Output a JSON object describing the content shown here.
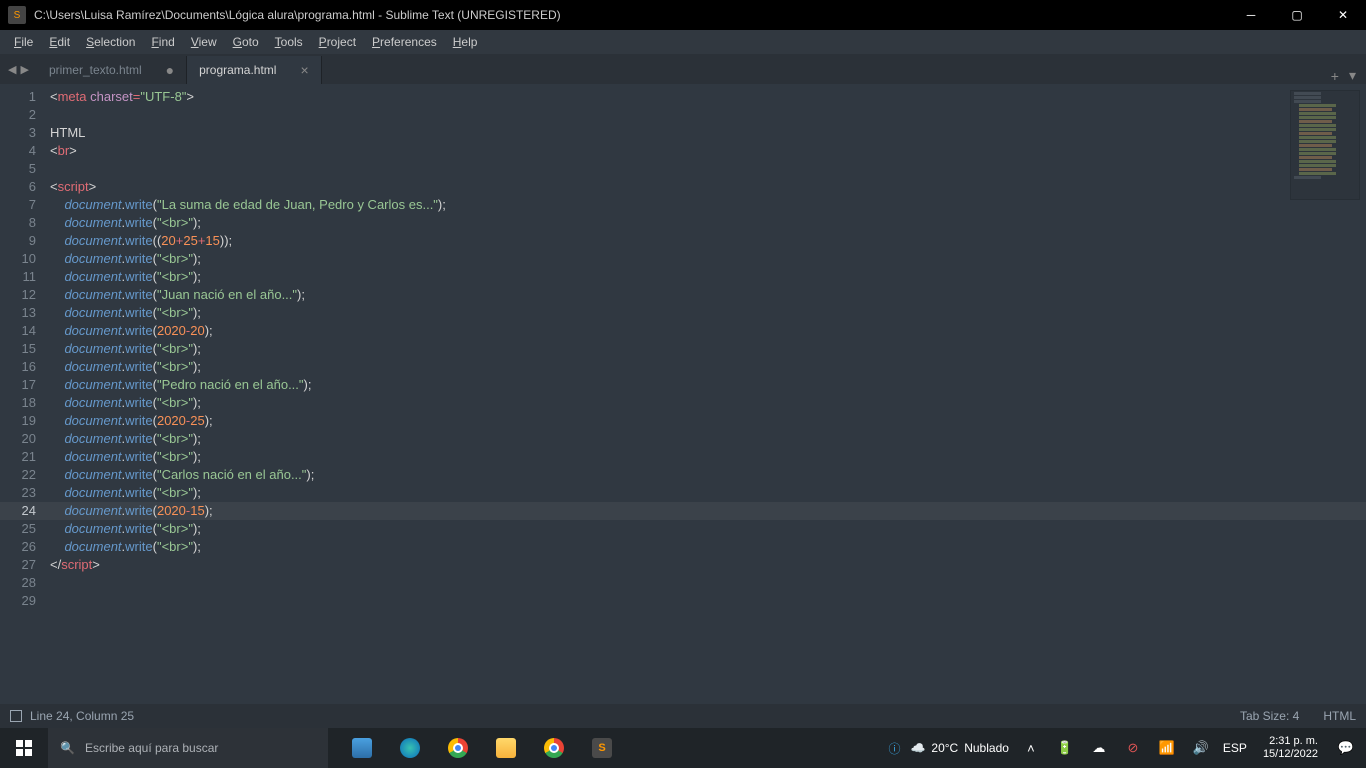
{
  "title": "C:\\Users\\Luisa Ramírez\\Documents\\Lógica alura\\programa.html - Sublime Text (UNREGISTERED)",
  "menus": [
    "File",
    "Edit",
    "Selection",
    "Find",
    "View",
    "Goto",
    "Tools",
    "Project",
    "Preferences",
    "Help"
  ],
  "tabs": [
    {
      "name": "primer_texto.html",
      "active": false,
      "dirty": true
    },
    {
      "name": "programa.html",
      "active": true,
      "dirty": false
    }
  ],
  "code_lines": [
    [
      {
        "c": "tok-punc",
        "t": "<"
      },
      {
        "c": "tok-tag",
        "t": "meta"
      },
      {
        "c": "tok-plain",
        "t": " "
      },
      {
        "c": "tok-attr",
        "t": "charset"
      },
      {
        "c": "tok-op",
        "t": "="
      },
      {
        "c": "tok-str",
        "t": "\"UTF-8\""
      },
      {
        "c": "tok-punc",
        "t": ">"
      }
    ],
    [],
    [
      {
        "c": "tok-text",
        "t": "HTML"
      }
    ],
    [
      {
        "c": "tok-punc",
        "t": "<"
      },
      {
        "c": "tok-tag",
        "t": "br"
      },
      {
        "c": "tok-punc",
        "t": ">"
      }
    ],
    [],
    [
      {
        "c": "tok-punc",
        "t": "<"
      },
      {
        "c": "tok-tag",
        "t": "script"
      },
      {
        "c": "tok-punc",
        "t": ">"
      }
    ],
    [
      {
        "c": "tok-plain",
        "t": "    "
      },
      {
        "c": "tok-kw",
        "t": "document"
      },
      {
        "c": "tok-punc",
        "t": "."
      },
      {
        "c": "tok-func",
        "t": "write"
      },
      {
        "c": "tok-punc",
        "t": "("
      },
      {
        "c": "tok-str",
        "t": "\"La suma de edad de Juan, Pedro y Carlos es...\""
      },
      {
        "c": "tok-punc",
        "t": ");"
      }
    ],
    [
      {
        "c": "tok-plain",
        "t": "    "
      },
      {
        "c": "tok-kw",
        "t": "document"
      },
      {
        "c": "tok-punc",
        "t": "."
      },
      {
        "c": "tok-func",
        "t": "write"
      },
      {
        "c": "tok-punc",
        "t": "("
      },
      {
        "c": "tok-str",
        "t": "\"<br>\""
      },
      {
        "c": "tok-punc",
        "t": ");"
      }
    ],
    [
      {
        "c": "tok-plain",
        "t": "    "
      },
      {
        "c": "tok-kw",
        "t": "document"
      },
      {
        "c": "tok-punc",
        "t": "."
      },
      {
        "c": "tok-func",
        "t": "write"
      },
      {
        "c": "tok-punc",
        "t": "(("
      },
      {
        "c": "tok-num",
        "t": "20"
      },
      {
        "c": "tok-op",
        "t": "+"
      },
      {
        "c": "tok-num",
        "t": "25"
      },
      {
        "c": "tok-op",
        "t": "+"
      },
      {
        "c": "tok-num",
        "t": "15"
      },
      {
        "c": "tok-punc",
        "t": "));"
      }
    ],
    [
      {
        "c": "tok-plain",
        "t": "    "
      },
      {
        "c": "tok-kw",
        "t": "document"
      },
      {
        "c": "tok-punc",
        "t": "."
      },
      {
        "c": "tok-func",
        "t": "write"
      },
      {
        "c": "tok-punc",
        "t": "("
      },
      {
        "c": "tok-str",
        "t": "\"<br>\""
      },
      {
        "c": "tok-punc",
        "t": ");"
      }
    ],
    [
      {
        "c": "tok-plain",
        "t": "    "
      },
      {
        "c": "tok-kw",
        "t": "document"
      },
      {
        "c": "tok-punc",
        "t": "."
      },
      {
        "c": "tok-func",
        "t": "write"
      },
      {
        "c": "tok-punc",
        "t": "("
      },
      {
        "c": "tok-str",
        "t": "\"<br>\""
      },
      {
        "c": "tok-punc",
        "t": ");"
      }
    ],
    [
      {
        "c": "tok-plain",
        "t": "    "
      },
      {
        "c": "tok-kw",
        "t": "document"
      },
      {
        "c": "tok-punc",
        "t": "."
      },
      {
        "c": "tok-func",
        "t": "write"
      },
      {
        "c": "tok-punc",
        "t": "("
      },
      {
        "c": "tok-str",
        "t": "\"Juan nació en el año...\""
      },
      {
        "c": "tok-punc",
        "t": ");"
      }
    ],
    [
      {
        "c": "tok-plain",
        "t": "    "
      },
      {
        "c": "tok-kw",
        "t": "document"
      },
      {
        "c": "tok-punc",
        "t": "."
      },
      {
        "c": "tok-func",
        "t": "write"
      },
      {
        "c": "tok-punc",
        "t": "("
      },
      {
        "c": "tok-str",
        "t": "\"<br>\""
      },
      {
        "c": "tok-punc",
        "t": ");"
      }
    ],
    [
      {
        "c": "tok-plain",
        "t": "    "
      },
      {
        "c": "tok-kw",
        "t": "document"
      },
      {
        "c": "tok-punc",
        "t": "."
      },
      {
        "c": "tok-func",
        "t": "write"
      },
      {
        "c": "tok-punc",
        "t": "("
      },
      {
        "c": "tok-num",
        "t": "2020"
      },
      {
        "c": "tok-op",
        "t": "-"
      },
      {
        "c": "tok-num",
        "t": "20"
      },
      {
        "c": "tok-punc",
        "t": ");"
      }
    ],
    [
      {
        "c": "tok-plain",
        "t": "    "
      },
      {
        "c": "tok-kw",
        "t": "document"
      },
      {
        "c": "tok-punc",
        "t": "."
      },
      {
        "c": "tok-func",
        "t": "write"
      },
      {
        "c": "tok-punc",
        "t": "("
      },
      {
        "c": "tok-str",
        "t": "\"<br>\""
      },
      {
        "c": "tok-punc",
        "t": ");"
      }
    ],
    [
      {
        "c": "tok-plain",
        "t": "    "
      },
      {
        "c": "tok-kw",
        "t": "document"
      },
      {
        "c": "tok-punc",
        "t": "."
      },
      {
        "c": "tok-func",
        "t": "write"
      },
      {
        "c": "tok-punc",
        "t": "("
      },
      {
        "c": "tok-str",
        "t": "\"<br>\""
      },
      {
        "c": "tok-punc",
        "t": ");"
      }
    ],
    [
      {
        "c": "tok-plain",
        "t": "    "
      },
      {
        "c": "tok-kw",
        "t": "document"
      },
      {
        "c": "tok-punc",
        "t": "."
      },
      {
        "c": "tok-func",
        "t": "write"
      },
      {
        "c": "tok-punc",
        "t": "("
      },
      {
        "c": "tok-str",
        "t": "\"Pedro nació en el año...\""
      },
      {
        "c": "tok-punc",
        "t": ");"
      }
    ],
    [
      {
        "c": "tok-plain",
        "t": "    "
      },
      {
        "c": "tok-kw",
        "t": "document"
      },
      {
        "c": "tok-punc",
        "t": "."
      },
      {
        "c": "tok-func",
        "t": "write"
      },
      {
        "c": "tok-punc",
        "t": "("
      },
      {
        "c": "tok-str",
        "t": "\"<br>\""
      },
      {
        "c": "tok-punc",
        "t": ");"
      }
    ],
    [
      {
        "c": "tok-plain",
        "t": "    "
      },
      {
        "c": "tok-kw",
        "t": "document"
      },
      {
        "c": "tok-punc",
        "t": "."
      },
      {
        "c": "tok-func",
        "t": "write"
      },
      {
        "c": "tok-punc",
        "t": "("
      },
      {
        "c": "tok-num",
        "t": "2020"
      },
      {
        "c": "tok-op",
        "t": "-"
      },
      {
        "c": "tok-num",
        "t": "25"
      },
      {
        "c": "tok-punc",
        "t": ");"
      }
    ],
    [
      {
        "c": "tok-plain",
        "t": "    "
      },
      {
        "c": "tok-kw",
        "t": "document"
      },
      {
        "c": "tok-punc",
        "t": "."
      },
      {
        "c": "tok-func",
        "t": "write"
      },
      {
        "c": "tok-punc",
        "t": "("
      },
      {
        "c": "tok-str",
        "t": "\"<br>\""
      },
      {
        "c": "tok-punc",
        "t": ");"
      }
    ],
    [
      {
        "c": "tok-plain",
        "t": "    "
      },
      {
        "c": "tok-kw",
        "t": "document"
      },
      {
        "c": "tok-punc",
        "t": "."
      },
      {
        "c": "tok-func",
        "t": "write"
      },
      {
        "c": "tok-punc",
        "t": "("
      },
      {
        "c": "tok-str",
        "t": "\"<br>\""
      },
      {
        "c": "tok-punc",
        "t": ");"
      }
    ],
    [
      {
        "c": "tok-plain",
        "t": "    "
      },
      {
        "c": "tok-kw",
        "t": "document"
      },
      {
        "c": "tok-punc",
        "t": "."
      },
      {
        "c": "tok-func",
        "t": "write"
      },
      {
        "c": "tok-punc",
        "t": "("
      },
      {
        "c": "tok-str",
        "t": "\"Carlos nació en el año...\""
      },
      {
        "c": "tok-punc",
        "t": ");"
      }
    ],
    [
      {
        "c": "tok-plain",
        "t": "    "
      },
      {
        "c": "tok-kw",
        "t": "document"
      },
      {
        "c": "tok-punc",
        "t": "."
      },
      {
        "c": "tok-func",
        "t": "write"
      },
      {
        "c": "tok-punc",
        "t": "("
      },
      {
        "c": "tok-str",
        "t": "\"<br>\""
      },
      {
        "c": "tok-punc",
        "t": ");"
      }
    ],
    [
      {
        "c": "tok-plain",
        "t": "    "
      },
      {
        "c": "tok-kw",
        "t": "document"
      },
      {
        "c": "tok-punc",
        "t": "."
      },
      {
        "c": "tok-func",
        "t": "write"
      },
      {
        "c": "tok-punc",
        "t": "("
      },
      {
        "c": "tok-num",
        "t": "2020"
      },
      {
        "c": "tok-op",
        "t": "-"
      },
      {
        "c": "tok-num",
        "t": "15"
      },
      {
        "c": "tok-punc",
        "t": ");"
      }
    ],
    [
      {
        "c": "tok-plain",
        "t": "    "
      },
      {
        "c": "tok-kw",
        "t": "document"
      },
      {
        "c": "tok-punc",
        "t": "."
      },
      {
        "c": "tok-func",
        "t": "write"
      },
      {
        "c": "tok-punc",
        "t": "("
      },
      {
        "c": "tok-str",
        "t": "\"<br>\""
      },
      {
        "c": "tok-punc",
        "t": ");"
      }
    ],
    [
      {
        "c": "tok-plain",
        "t": "    "
      },
      {
        "c": "tok-kw",
        "t": "document"
      },
      {
        "c": "tok-punc",
        "t": "."
      },
      {
        "c": "tok-func",
        "t": "write"
      },
      {
        "c": "tok-punc",
        "t": "("
      },
      {
        "c": "tok-str",
        "t": "\"<br>\""
      },
      {
        "c": "tok-punc",
        "t": ");"
      }
    ],
    [
      {
        "c": "tok-punc",
        "t": "</"
      },
      {
        "c": "tok-tag",
        "t": "script"
      },
      {
        "c": "tok-punc",
        "t": ">"
      }
    ],
    [],
    []
  ],
  "highlight_line": 24,
  "statusbar": {
    "position": "Line 24, Column 25",
    "tabsize": "Tab Size: 4",
    "syntax": "HTML"
  },
  "taskbar": {
    "search_placeholder": "Escribe aquí para buscar",
    "weather_temp": "20°C",
    "weather_cond": "Nublado",
    "lang": "ESP",
    "time": "2:31 p. m.",
    "date": "15/12/2022"
  }
}
